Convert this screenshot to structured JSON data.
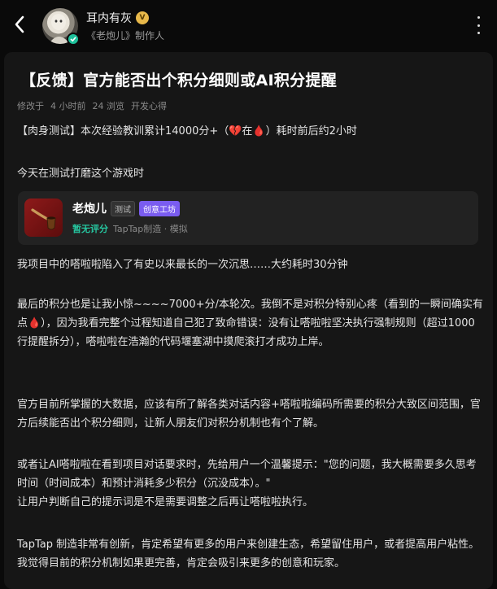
{
  "header": {
    "author_name": "耳内有灰",
    "level_badge": "V",
    "author_sub": "《老炮儿》制作人",
    "icons": [
      "back-arrow-icon",
      "verified-icon",
      "more-vertical-icon"
    ]
  },
  "post": {
    "title": "【反馈】官方能否出个积分细则或AI积分提醒",
    "meta": {
      "edited": "修改于",
      "time": "4 小时前",
      "views": "24 浏览",
      "category": "开发心得"
    },
    "para1": "【肉身测试】本次经验教训累计14000分+（💔在🩸）耗时前后约2小时",
    "para2": "今天在测试打磨这个游戏时",
    "game": {
      "name": "老炮儿",
      "tag_test": "测试",
      "tag_workshop": "创意工坊",
      "no_score": "暂无评分",
      "maker": "TapTap制造 · 模拟",
      "icon": "pipe-icon"
    },
    "para3": "我项目中的嗒啦啦陷入了有史以来最长的一次沉思……大约耗时30分钟",
    "para4": "最后的积分也是让我小惊~~~~7000+分/本轮次。我倒不是对积分特别心疼（看到的一瞬间确实有点🩸），因为我看完整个过程知道自己犯了致命错误：没有让嗒啦啦坚决执行强制规则（超过1000行提醒拆分），嗒啦啦在浩瀚的代码堰塞湖中摸爬滚打才成功上岸。",
    "para5": "官方目前所掌握的大数据，应该有所了解各类对话内容+嗒啦啦编码所需要的积分大致区间范围，官方后续能否出个积分细则，让新人朋友们对积分机制也有个了解。",
    "para6": "或者让AI嗒啦啦在看到项目对话要求时，先给用户一个温馨提示：\"您的问题，我大概需要多久思考时间（时间成本）和预计消耗多少积分（沉没成本）。\"\n让用户判断自己的提示词是不是需要调整之后再让嗒啦啦执行。",
    "para7": "TapTap 制造非常有创新，肯定希望有更多的用户来创建生态，希望留住用户，或者提高用户粘性。我觉得目前的积分机制如果更完善，肯定会吸引来更多的创意和玩家。"
  },
  "colors": {
    "background": "#0a0a0a",
    "card": "#161616",
    "accent_green": "#26c6a0",
    "workshop_purple": "#7a5cf0"
  }
}
